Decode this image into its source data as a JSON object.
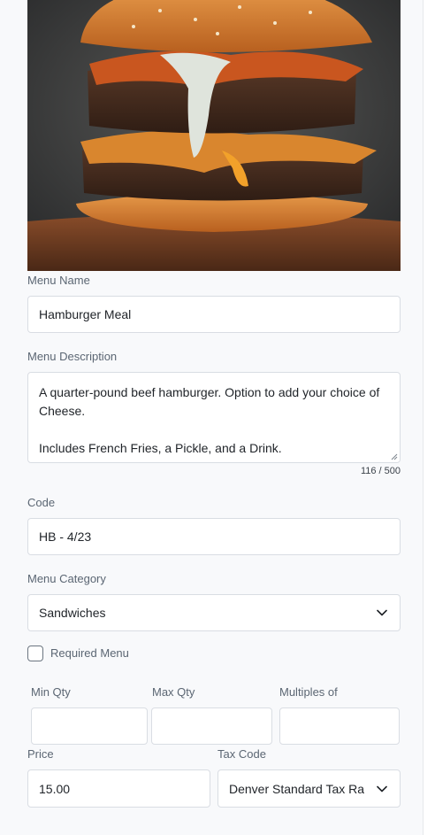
{
  "menu_item": {
    "image_alt": "Double cheeseburger with bacon and sauce",
    "name_label": "Menu Name",
    "name_value": "Hamburger Meal",
    "description_label": "Menu Description",
    "description_value": "A quarter-pound beef hamburger. Option to add your choice of Cheese.\n\nIncludes French Fries, a Pickle, and a Drink.",
    "description_counter": "116 / 500",
    "code_label": "Code",
    "code_value": "HB - 4/23",
    "category_label": "Menu Category",
    "category_value": "Sandwiches",
    "required_label": "Required Menu",
    "required_checked": false,
    "min_qty_label": "Min Qty",
    "min_qty_value": "",
    "max_qty_label": "Max Qty",
    "max_qty_value": "",
    "multiples_label": "Multiples of",
    "multiples_value": "",
    "price_label": "Price",
    "price_value": "15.00",
    "tax_code_label": "Tax Code",
    "tax_code_value": "Denver Standard Tax Ra"
  },
  "icons": {
    "select_chevron": "chevron-down-icon",
    "textarea_resize": "resize-grip-icon"
  },
  "colors": {
    "page_bg": "#f8f9fb",
    "field_border": "#d9dde3",
    "label_text": "#5b6673"
  }
}
